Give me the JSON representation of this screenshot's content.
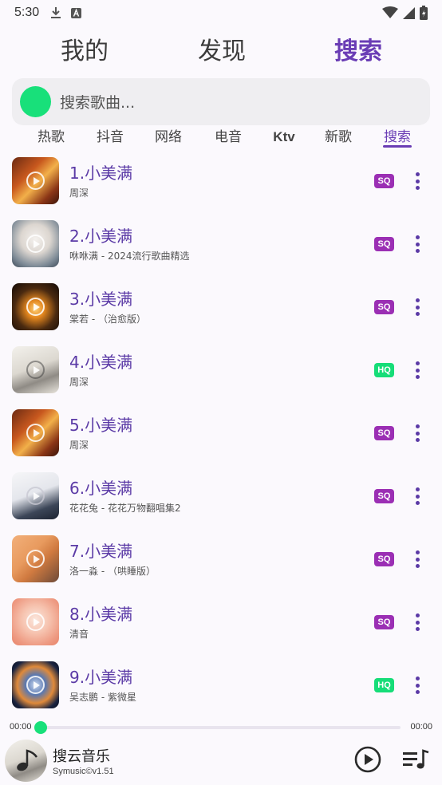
{
  "status_bar": {
    "time": "5:30"
  },
  "top_tabs": [
    {
      "label": "我的"
    },
    {
      "label": "发现"
    },
    {
      "label": "搜索"
    }
  ],
  "search": {
    "placeholder": "搜索歌曲..."
  },
  "categories": [
    {
      "label": "热歌"
    },
    {
      "label": "抖音"
    },
    {
      "label": "网络"
    },
    {
      "label": "电音"
    },
    {
      "label": "Ktv"
    },
    {
      "label": "新歌"
    },
    {
      "label": "搜索"
    }
  ],
  "songs": [
    {
      "title": "1.小美满",
      "subtitle": "周深",
      "quality": "SQ"
    },
    {
      "title": "2.小美满",
      "subtitle": "咻咻满 - 2024流行歌曲精选",
      "quality": "SQ"
    },
    {
      "title": "3.小美满",
      "subtitle": "棠若 - （治愈版）",
      "quality": "SQ"
    },
    {
      "title": "4.小美满",
      "subtitle": "周深",
      "quality": "HQ"
    },
    {
      "title": "5.小美满",
      "subtitle": "周深",
      "quality": "SQ"
    },
    {
      "title": "6.小美满",
      "subtitle": "花花兔 - 花花万物翻唱集2",
      "quality": "SQ"
    },
    {
      "title": "7.小美满",
      "subtitle": "洛一淼 - （哄睡版）",
      "quality": "SQ"
    },
    {
      "title": "8.小美满",
      "subtitle": "清音",
      "quality": "SQ"
    },
    {
      "title": "9.小美满",
      "subtitle": "吴志鹏 - 紫微星",
      "quality": "HQ"
    }
  ],
  "player": {
    "time_current": "00:00",
    "time_total": "00:00",
    "progress": 0,
    "title": "搜云音乐",
    "subtitle": "Symusic©v1.51"
  },
  "colors": {
    "accent": "#6a3db5",
    "green": "#18e07a",
    "sq_badge": "#9b2fb4",
    "hq_badge": "#16dd78"
  }
}
